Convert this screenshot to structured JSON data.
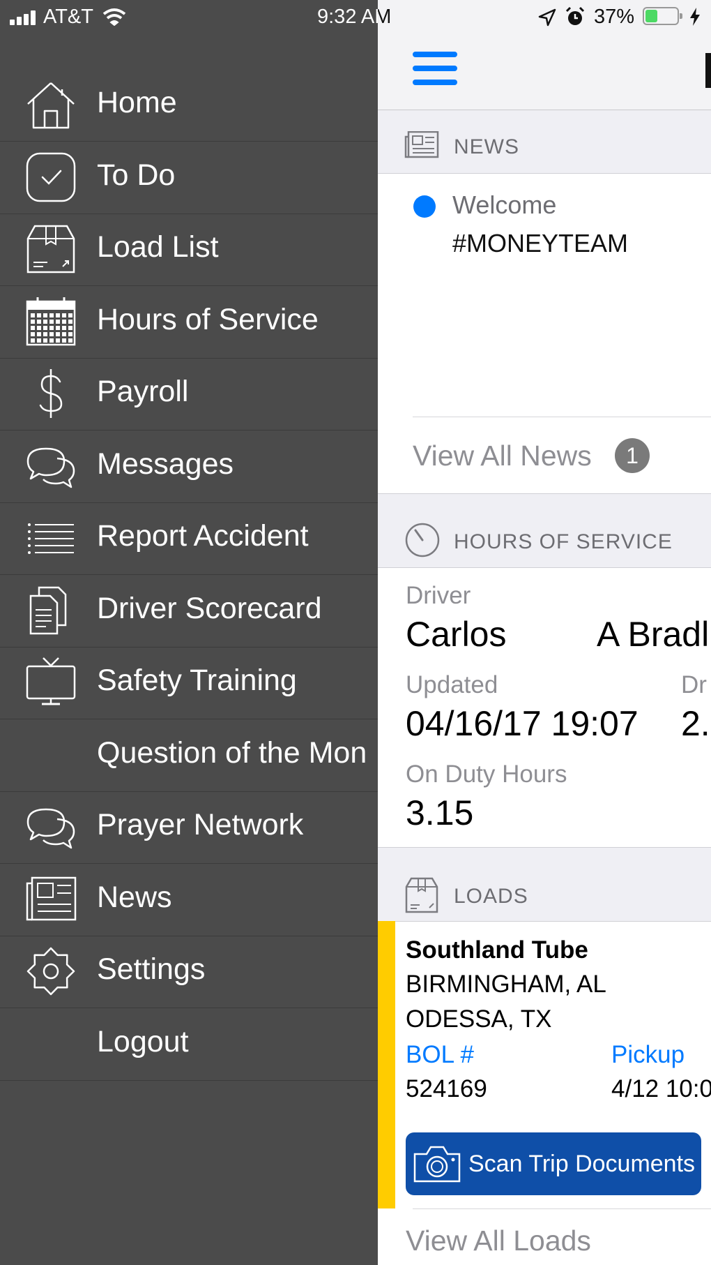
{
  "status_bar": {
    "carrier": "AT&T",
    "time": "9:32 AM",
    "battery": "37%"
  },
  "menu": {
    "items": [
      {
        "label": "Home",
        "icon": "home-icon"
      },
      {
        "label": "To Do",
        "icon": "checkbox-icon"
      },
      {
        "label": "Load List",
        "icon": "box-icon"
      },
      {
        "label": "Hours of Service",
        "icon": "calendar-icon"
      },
      {
        "label": "Payroll",
        "icon": "dollar-icon"
      },
      {
        "label": "Messages",
        "icon": "chat-bubbles-icon"
      },
      {
        "label": "Report Accident",
        "icon": "list-icon"
      },
      {
        "label": "Driver Scorecard",
        "icon": "documents-icon"
      },
      {
        "label": "Safety Training",
        "icon": "tv-icon"
      },
      {
        "label": "Question of the Mon",
        "icon": ""
      },
      {
        "label": "Prayer Network",
        "icon": "chat-bubbles-icon"
      },
      {
        "label": "News",
        "icon": "newspaper-icon"
      },
      {
        "label": "Settings",
        "icon": "gear-icon"
      },
      {
        "label": "Logout",
        "icon": ""
      }
    ]
  },
  "news": {
    "section_title": "NEWS",
    "item_title": "Welcome",
    "item_body": "#MONEYTEAM",
    "view_all": "View All News",
    "count": "1"
  },
  "hos": {
    "section_title": "HOURS OF SERVICE",
    "driver_label": "Driver",
    "driver_first": "Carlos",
    "driver_last": "A Bradl",
    "updated_label": "Updated",
    "updated_value": "04/16/17 19:07",
    "dr_label": "Dr",
    "dr_value": "2.",
    "on_duty_label": "On Duty Hours",
    "on_duty_value": "3.15"
  },
  "loads": {
    "section_title": "LOADS",
    "company": "Southland Tube",
    "origin": "BIRMINGHAM, AL",
    "destination": "ODESSA, TX",
    "bol_label": "BOL #",
    "bol_value": "524169",
    "pickup_label": "Pickup",
    "pickup_value": "4/12 10:0",
    "scan_button": "Scan Trip Documents",
    "view_all": "View All Loads"
  },
  "colors": {
    "accent": "#007aff",
    "menu_bg": "#4b4b4b",
    "scan_button": "#0f4fa8",
    "load_stripe": "#ffcc00"
  }
}
